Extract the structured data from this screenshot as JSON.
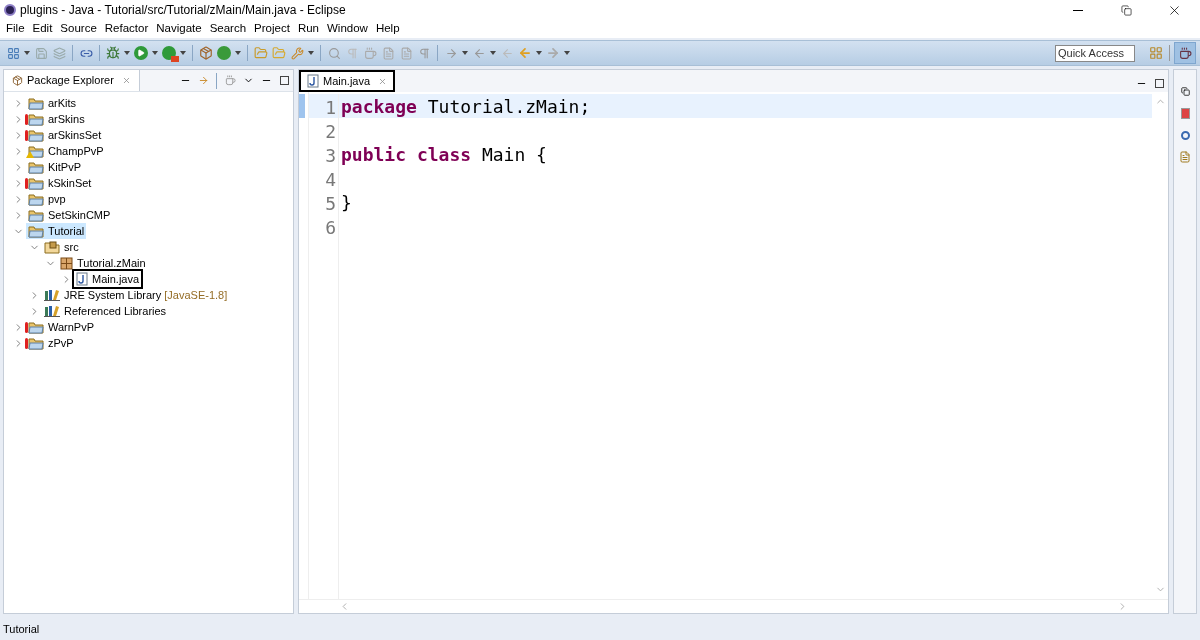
{
  "window": {
    "title": "plugins - Java - Tutorial/src/Tutorial/zMain/Main.java - Eclipse"
  },
  "menu": [
    "File",
    "Edit",
    "Source",
    "Refactor",
    "Navigate",
    "Search",
    "Project",
    "Run",
    "Window",
    "Help"
  ],
  "toolbar": {
    "quick_access": "Quick Access"
  },
  "package_explorer": {
    "title": "Package Explorer",
    "tree": [
      {
        "label": "arKits",
        "kind": "project",
        "error": false,
        "warning": false,
        "expanded": false,
        "selected": false,
        "highlighted": false
      },
      {
        "label": "arSkins",
        "kind": "project",
        "error": true,
        "warning": false,
        "expanded": false,
        "selected": false,
        "highlighted": false
      },
      {
        "label": "arSkinsSet",
        "kind": "project",
        "error": true,
        "warning": false,
        "expanded": false,
        "selected": false,
        "highlighted": false
      },
      {
        "label": "ChampPvP",
        "kind": "project",
        "error": false,
        "warning": true,
        "expanded": false,
        "selected": false,
        "highlighted": false
      },
      {
        "label": "KitPvP",
        "kind": "project",
        "error": false,
        "warning": false,
        "expanded": false,
        "selected": false,
        "highlighted": false
      },
      {
        "label": "kSkinSet",
        "kind": "project",
        "error": true,
        "warning": false,
        "expanded": false,
        "selected": false,
        "highlighted": false
      },
      {
        "label": "pvp",
        "kind": "project",
        "error": false,
        "warning": false,
        "expanded": false,
        "selected": false,
        "highlighted": false
      },
      {
        "label": "SetSkinCMP",
        "kind": "project",
        "error": false,
        "warning": false,
        "expanded": false,
        "selected": false,
        "highlighted": false
      },
      {
        "label": "Tutorial",
        "kind": "project",
        "error": false,
        "warning": false,
        "expanded": true,
        "selected": true,
        "highlighted": false,
        "children": [
          {
            "label": "src",
            "kind": "source",
            "error": false,
            "warning": false,
            "expanded": true,
            "selected": false,
            "highlighted": false,
            "children": [
              {
                "label": "Tutorial.zMain",
                "kind": "package",
                "error": false,
                "warning": false,
                "expanded": true,
                "selected": false,
                "highlighted": false,
                "children": [
                  {
                    "label": "Main.java",
                    "kind": "file",
                    "error": false,
                    "warning": false,
                    "expanded": false,
                    "selected": false,
                    "highlighted": true
                  }
                ]
              }
            ]
          },
          {
            "label": "JRE System Library",
            "suffix": "[JavaSE-1.8]",
            "kind": "library",
            "error": false,
            "warning": false,
            "expanded": false,
            "selected": false,
            "highlighted": false
          },
          {
            "label": "Referenced Libraries",
            "kind": "library",
            "error": false,
            "warning": false,
            "expanded": false,
            "selected": false,
            "highlighted": false
          }
        ]
      },
      {
        "label": "WarnPvP",
        "kind": "project",
        "error": true,
        "warning": false,
        "expanded": false,
        "selected": false,
        "highlighted": false
      },
      {
        "label": "zPvP",
        "kind": "project",
        "error": true,
        "warning": false,
        "expanded": false,
        "selected": false,
        "highlighted": false
      }
    ]
  },
  "editor": {
    "tabs": [
      {
        "label": "Main.java",
        "selected": true,
        "highlighted": true
      }
    ],
    "lines": [
      {
        "number": "1",
        "current": true,
        "tokens": [
          {
            "kind": "keyword",
            "text": "package"
          },
          {
            "kind": "plain",
            "text": "Tutorial.zMain;"
          }
        ]
      },
      {
        "number": "2",
        "current": false
      },
      {
        "number": "3",
        "current": false,
        "tokens": [
          {
            "kind": "keyword",
            "text": "public"
          },
          {
            "kind": "keyword",
            "text": "class"
          },
          {
            "kind": "plain",
            "text": "Main {"
          }
        ]
      },
      {
        "number": "4",
        "current": false
      },
      {
        "number": "5",
        "current": false,
        "tokens": [
          {
            "kind": "plain",
            "text": "}"
          }
        ]
      },
      {
        "number": "6",
        "current": false
      }
    ]
  },
  "status_bar": {
    "text": "Tutorial"
  }
}
